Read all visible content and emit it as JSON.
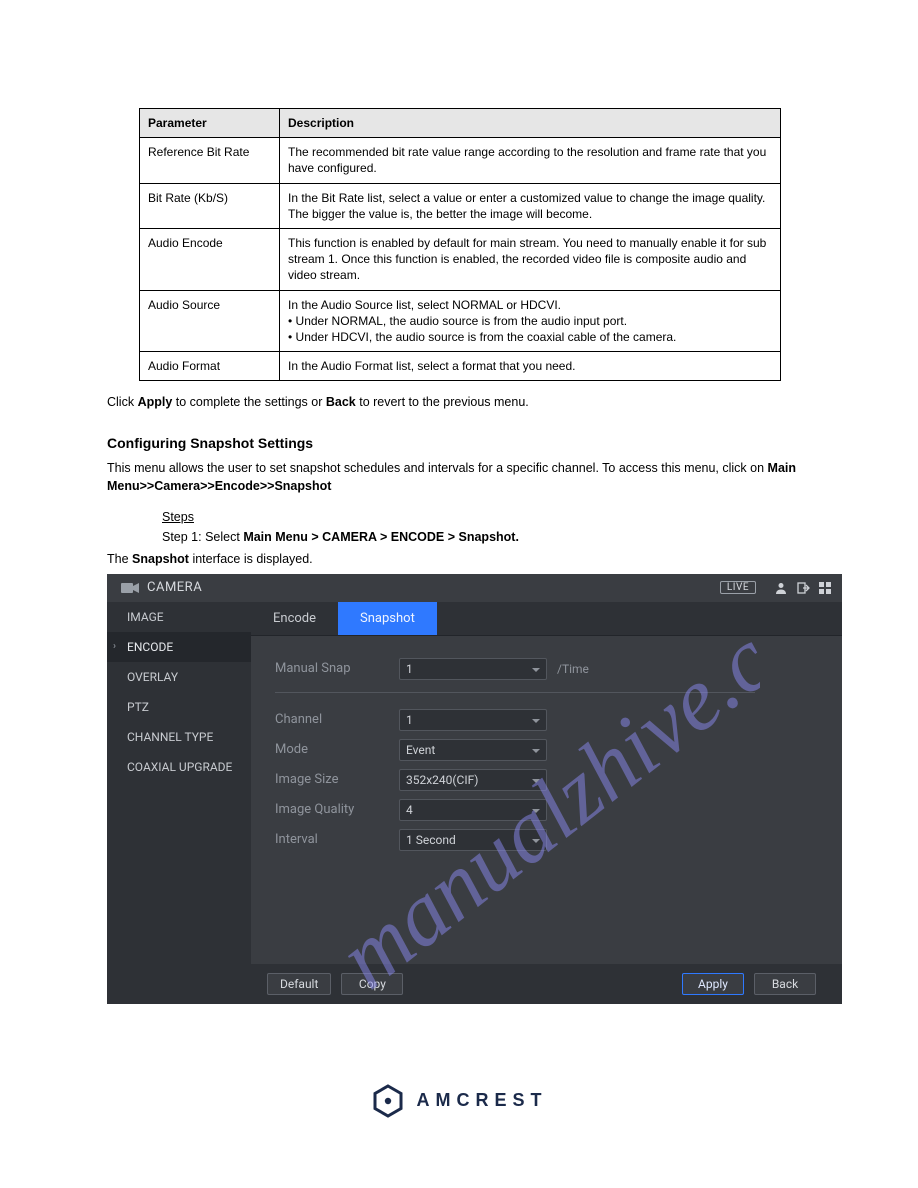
{
  "table": {
    "head": {
      "param": "Parameter",
      "desc": "Description"
    },
    "rows": [
      {
        "param": "Reference Bit Rate",
        "desc": "The recommended bit rate value range according to the resolution and frame rate that you have configured."
      },
      {
        "param": "Bit Rate (Kb/S)",
        "desc": "In the Bit Rate list, select a value or enter a customized value to change the image quality. The bigger the value is, the better the image will become."
      },
      {
        "param": "Audio Encode",
        "desc": "This function is enabled by default for main stream. You need to manually enable it for sub stream 1. Once this function is enabled, the recorded video file is composite audio and video stream."
      },
      {
        "param": "Audio Source",
        "desc": "In the Audio Source list, select NORMAL or HDCVI.\n• Under NORMAL, the audio source is from the audio input port.\n• Under HDCVI, the audio source is from the coaxial cable of the camera."
      },
      {
        "param": "Audio Format",
        "desc": "In the Audio Format list, select a format that you need."
      }
    ]
  },
  "section": {
    "afterTable": {
      "pre": "Click ",
      "b1": "Apply",
      "mid": " to complete the settings or ",
      "b2": "Back",
      "post": " to revert to the previous menu."
    },
    "heading": "Configuring Snapshot Settings",
    "intro": {
      "pre": "This menu allows the user to set snapshot schedules and intervals for a specific channel. To access this menu, click on",
      "b1": "Main Menu>>Camera>>Encode>>Snapshot"
    },
    "stepsTitle": "Steps",
    "step1": {
      "n": "Step 1: ",
      "pre": "Select ",
      "b1": "Main Menu > CAMERA > ENCODE > Snapshot."
    },
    "substep": {
      "pre": "The ",
      "b1": "Snapshot",
      "post": " interface is displayed."
    }
  },
  "app": {
    "title": "CAMERA",
    "badge": "LIVE",
    "sidebar": [
      "IMAGE",
      "ENCODE",
      "OVERLAY",
      "PTZ",
      "CHANNEL TYPE",
      "COAXIAL UPGRADE"
    ],
    "tabs": [
      "Encode",
      "Snapshot"
    ],
    "form": {
      "manualSnapLabel": "Manual Snap",
      "manualSnapValue": "1",
      "manualSnapSuffix": "/Time",
      "channelLabel": "Channel",
      "channelValue": "1",
      "modeLabel": "Mode",
      "modeValue": "Event",
      "imageSizeLabel": "Image Size",
      "imageSizeValue": "352x240(CIF)",
      "imageQualityLabel": "Image Quality",
      "imageQualityValue": "4",
      "intervalLabel": "Interval",
      "intervalValue": "1 Second"
    },
    "buttons": {
      "default": "Default",
      "copy": "Copy",
      "apply": "Apply",
      "back": "Back"
    }
  },
  "logo": {
    "text": "AMCREST"
  }
}
